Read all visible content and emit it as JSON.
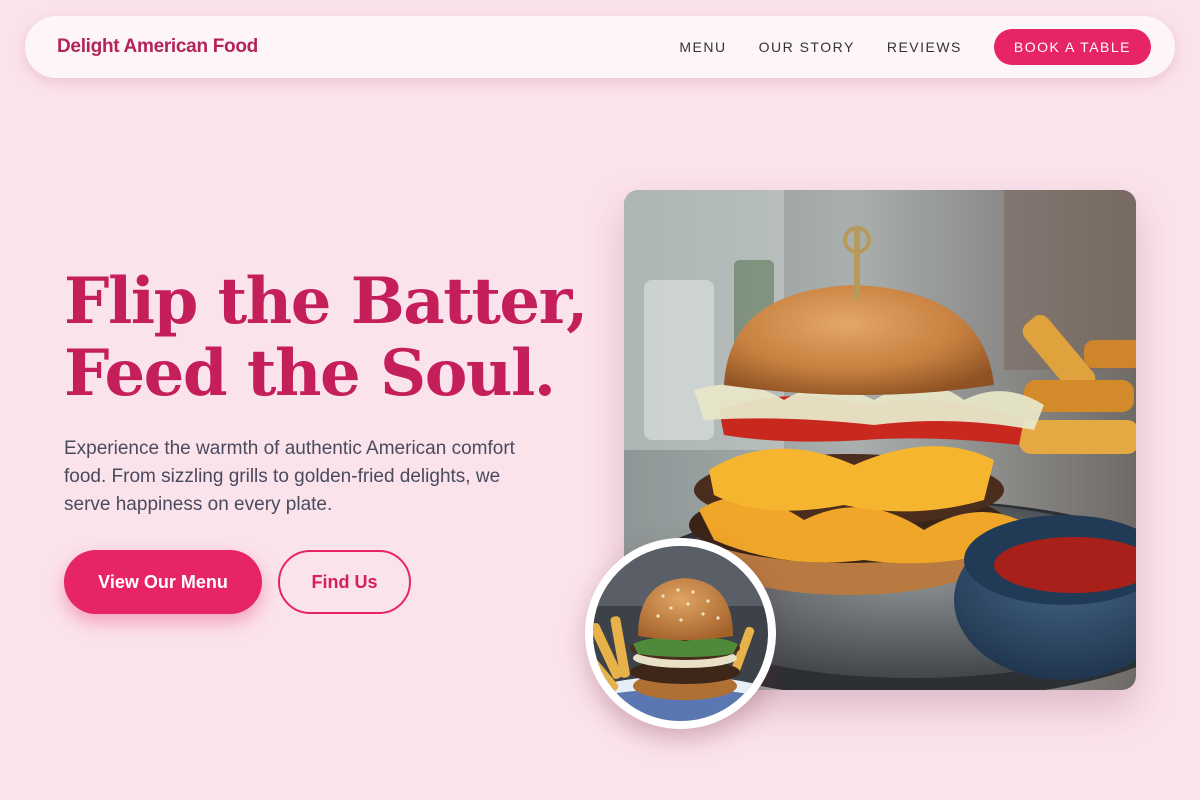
{
  "nav": {
    "brand": "Delight American Food",
    "links": [
      "MENU",
      "OUR STORY",
      "REVIEWS"
    ],
    "cta": "BOOK A TABLE"
  },
  "hero": {
    "title_line1": "Flip the Batter,",
    "title_line2": "Feed the Soul.",
    "description": "Experience the warmth of authentic American comfort food. From sizzling grills to golden-fried delights, we serve happiness on every plate.",
    "primary_button": "View Our Menu",
    "secondary_button": "Find Us"
  },
  "images": {
    "main_alt": "Double cheeseburger with fries and ketchup",
    "thumb_alt": "Sesame bun burger with fries"
  },
  "colors": {
    "background": "#fbe3ec",
    "accent": "#e62466",
    "brand": "#b3245a",
    "headline": "#c41e5b",
    "body_text": "#4a4a5e"
  }
}
